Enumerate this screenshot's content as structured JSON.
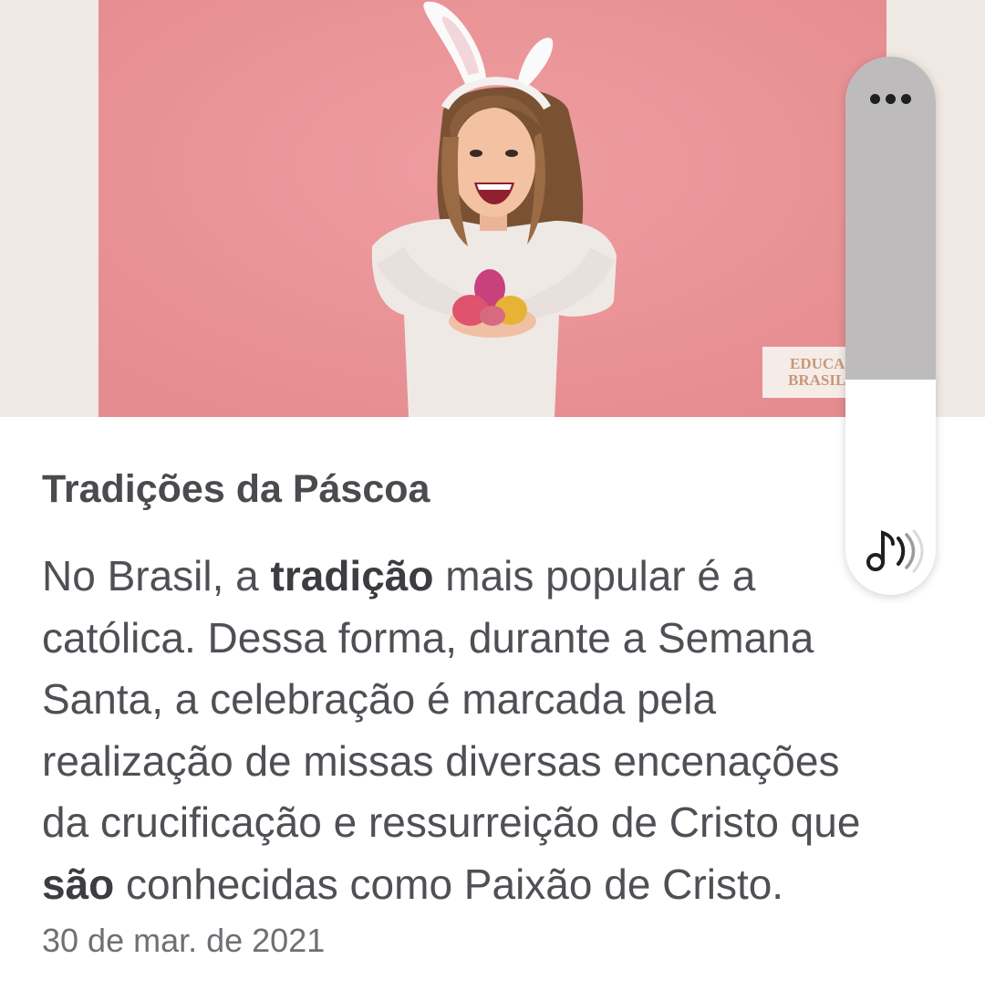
{
  "hero": {
    "watermark_line1": "EDUCA",
    "watermark_line2": "BRASIL"
  },
  "article": {
    "title": "Tradições da Páscoa",
    "body_lines": [
      [
        "No Brasil, a ",
        "tradição",
        " mais popular é a"
      ],
      [
        "católica. Dessa forma, durante a Semana"
      ],
      [
        "Santa, a celebração é marcada pela"
      ],
      [
        "realização de missas diversas encenações"
      ],
      [
        "da crucificação e ressurreição de Cristo que"
      ],
      [
        "",
        "são",
        " conhecidas como Paixão de Cristo."
      ]
    ],
    "date": "30 de mar. de 2021"
  },
  "player": {
    "level": 0.6,
    "menu_icon": "more-horizontal-icon",
    "audio_icon": "music-note-sound-icon"
  },
  "colors": {
    "hero_background": "#e99397",
    "page_band": "#f0e9e3",
    "title": "#4a4a4f",
    "body": "#4f4f55",
    "date": "#6f6f74",
    "slider_fill": "#bdbbbb"
  }
}
